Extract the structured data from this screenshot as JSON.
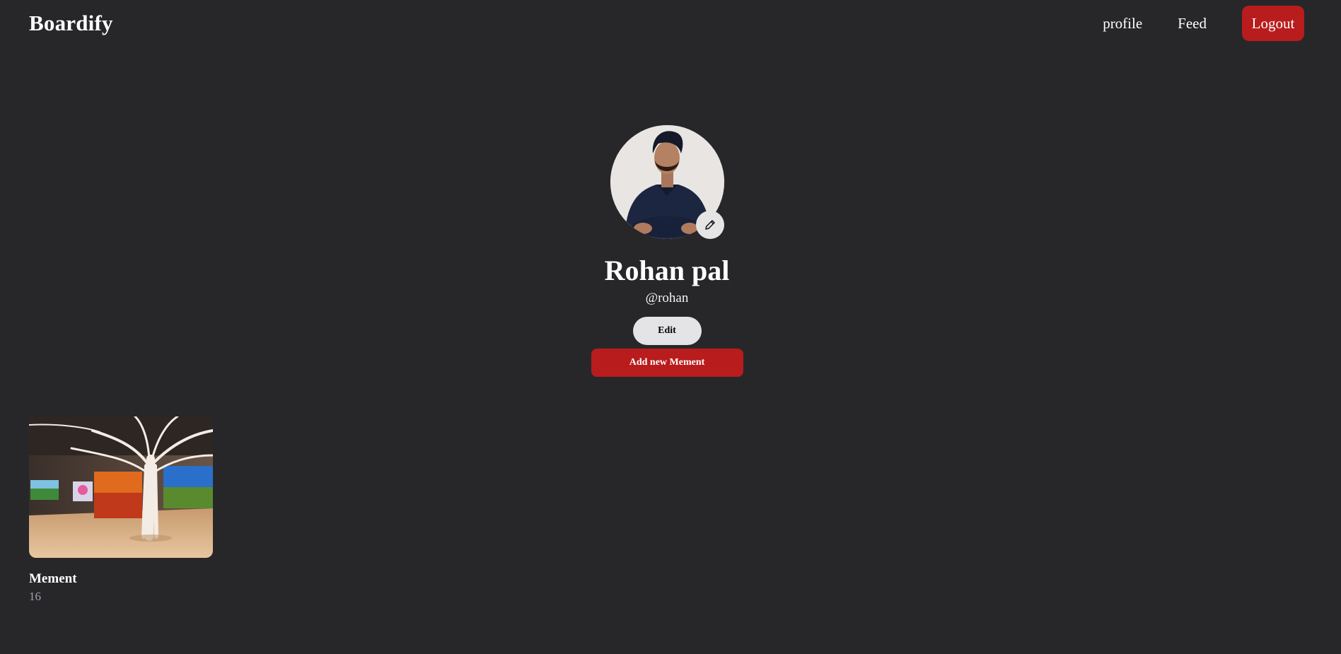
{
  "nav": {
    "brand": "Boardify",
    "links": [
      "profile",
      "Feed"
    ],
    "logout_label": "Logout"
  },
  "profile": {
    "name": "Rohan pal",
    "handle": "@rohan",
    "edit_label": "Edit",
    "add_label": "Add new Mement",
    "edit_avatar_icon": "pencil-icon"
  },
  "boards": [
    {
      "title": "Mement",
      "count": "16"
    }
  ],
  "colors": {
    "background": "#27272a",
    "accent": "#b91c1c",
    "light_button": "#e4e4e7"
  }
}
